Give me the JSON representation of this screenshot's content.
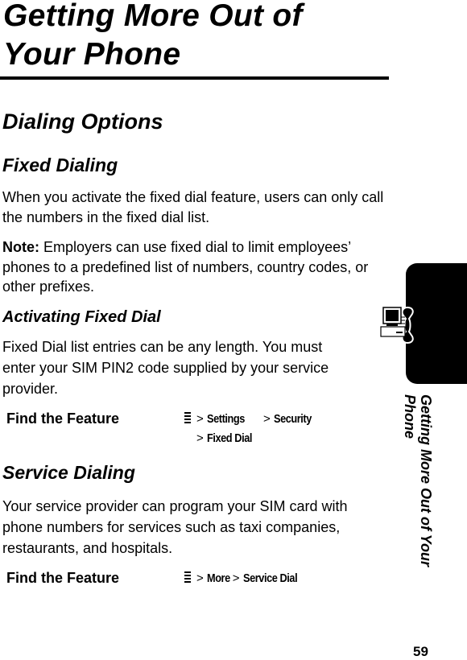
{
  "chapter": {
    "title_line1": "Getting More Out of",
    "title_line2": "Your Phone"
  },
  "section": {
    "title": "Dialing Options"
  },
  "fixed_dialing": {
    "heading": "Fixed Dialing",
    "body": "When you activate the fixed dial feature, users can only call the numbers in the fixed dial list.",
    "note_label": "Note:",
    "note_text": " Employers can use fixed dial to limit employees’ phones to a predefined list of numbers, country codes, or other prefixes.",
    "activating": {
      "heading": "Activating Fixed Dial",
      "body": "Fixed Dial list entries can be any length. You must enter your SIM PIN2 code supplied by your service provider."
    },
    "find_feature": {
      "label": "Find the Feature",
      "menu_icon": "menu-key-icon",
      "separator": ">",
      "path": [
        "Settings",
        "Security",
        "Fixed Dial"
      ]
    }
  },
  "service_dialing": {
    "heading": "Service Dialing",
    "body": "Your service provider can program your SIM card with phone numbers for services such as taxi companies, restaurants, and hospitals.",
    "find_feature": {
      "label": "Find the Feature",
      "menu_icon": "menu-key-icon",
      "separator": ">",
      "path": [
        "More",
        "Service Dial"
      ]
    }
  },
  "side_tab": {
    "icon": "computer-phone-icon",
    "title_line1": "Getting More Out of Your",
    "title_line2": "Phone"
  },
  "page_number": "59"
}
